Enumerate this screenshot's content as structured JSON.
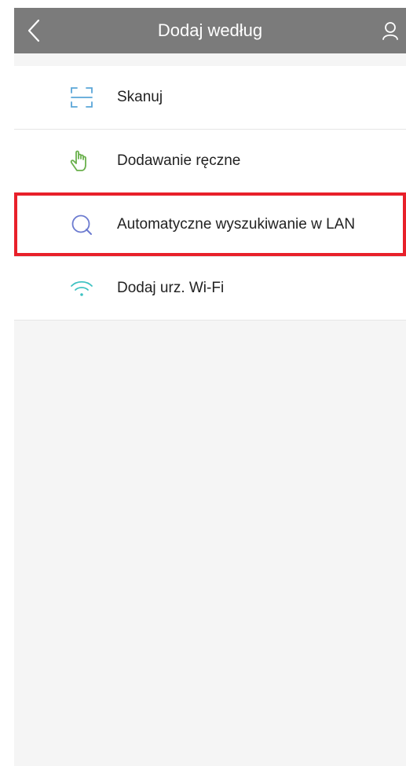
{
  "header": {
    "title": "Dodaj według",
    "back_icon": "chevron-left-icon",
    "user_icon": "user-icon"
  },
  "menu": {
    "items": [
      {
        "label": "Skanuj",
        "icon": "scan-icon",
        "icon_color": "#5aa6d8"
      },
      {
        "label": "Dodawanie ręczne",
        "icon": "hand-pointer-icon",
        "icon_color": "#6ab04c"
      },
      {
        "label": "Automatyczne wyszukiwanie w LAN",
        "icon": "search-lan-icon",
        "icon_color": "#6c7bd0"
      },
      {
        "label": "Dodaj urz. Wi-Fi",
        "icon": "wifi-icon",
        "icon_color": "#3ec2c2"
      }
    ]
  },
  "colors": {
    "header_bg": "#7b7b7b",
    "highlight_border": "#e8202a",
    "page_bg": "#f5f5f5"
  }
}
